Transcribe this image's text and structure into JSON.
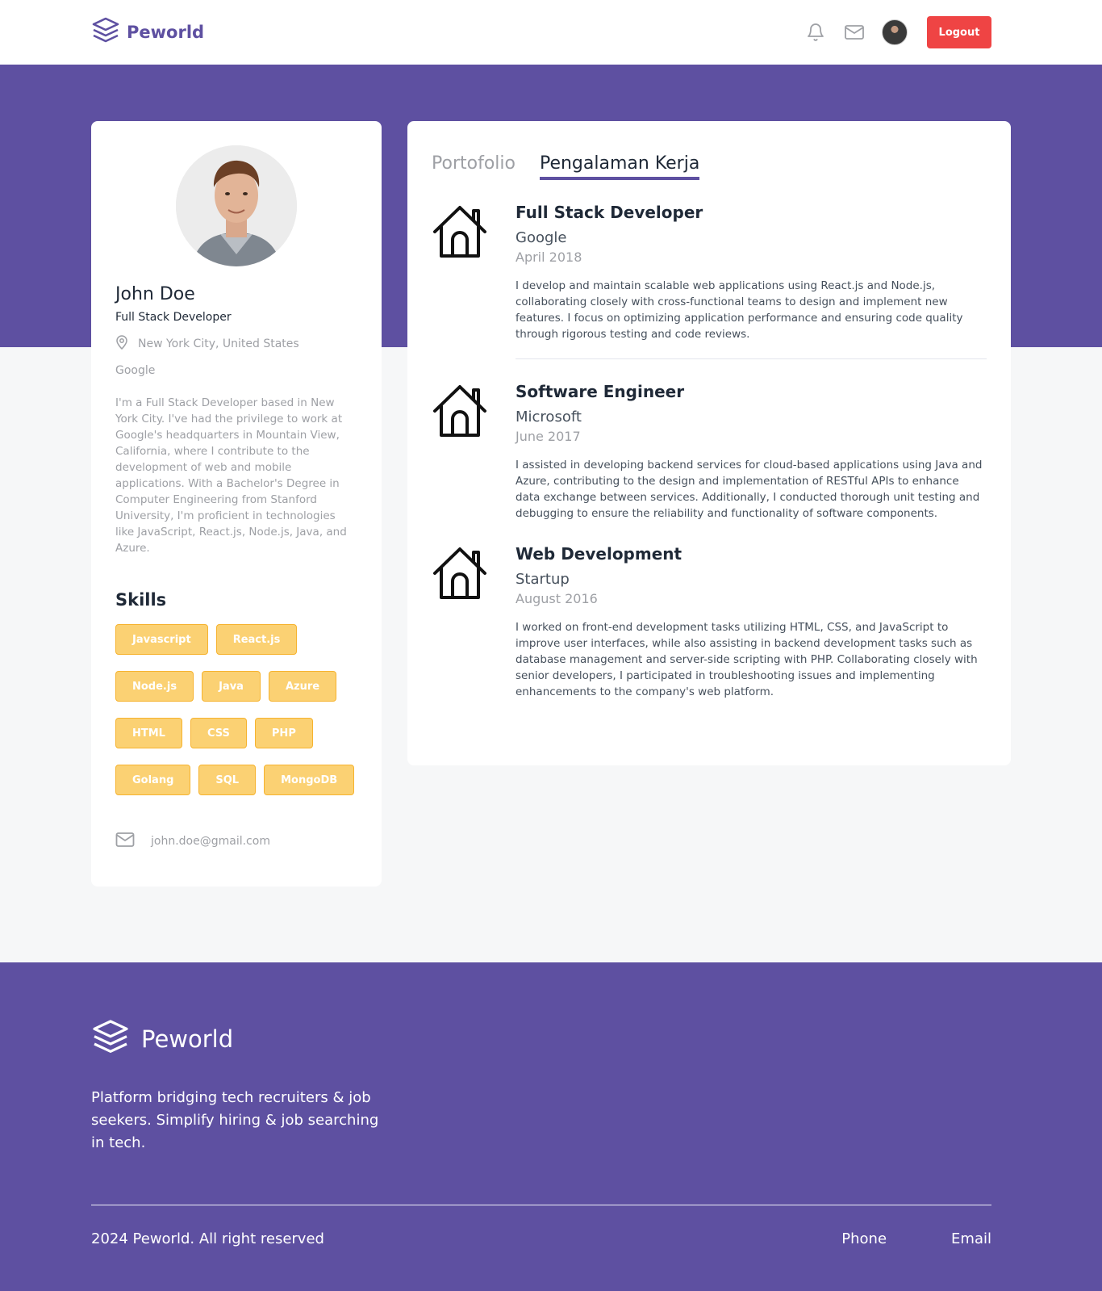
{
  "navbar": {
    "brand": "Peworld",
    "logout_label": "Logout"
  },
  "profile": {
    "name": "John Doe",
    "role": "Full Stack Developer",
    "location": "New York City, United States",
    "company": "Google",
    "bio": "I'm a Full Stack Developer based in New York City. I've had the privilege to work at Google's headquarters in Mountain View, California, where I contribute to the development of web and mobile applications. With a Bachelor's Degree in Computer Engineering from Stanford University, I'm proficient in technologies like JavaScript, React.js, Node.js, Java, and Azure.",
    "skills_title": "Skills",
    "skills": [
      "Javascript",
      "React.js",
      "Node.js",
      "Java",
      "Azure",
      "HTML",
      "CSS",
      "PHP",
      "Golang",
      "SQL",
      "MongoDB"
    ],
    "email": "john.doe@gmail.com"
  },
  "tabs": {
    "portfolio": "Portofolio",
    "experience": "Pengalaman Kerja",
    "active": "experience"
  },
  "experience": [
    {
      "title": "Full Stack Developer",
      "company": "Google",
      "date": "April 2018",
      "description": "I develop and maintain scalable web applications using React.js and Node.js, collaborating closely with cross-functional teams to design and implement new features. I focus on optimizing application performance and ensuring code quality through rigorous testing and code reviews."
    },
    {
      "title": "Software Engineer",
      "company": "Microsoft",
      "date": "June 2017",
      "description": "I assisted in developing backend services for cloud-based applications using Java and Azure, contributing to the design and implementation of RESTful APIs to enhance data exchange between services. Additionally, I conducted thorough unit testing and debugging to ensure the reliability and functionality of software components."
    },
    {
      "title": "Web Development",
      "company": "Startup",
      "date": "August 2016",
      "description": "I worked on front-end development tasks utilizing HTML, CSS, and JavaScript to improve user interfaces, while also assisting in backend development tasks such as database management and server-side scripting with PHP. Collaborating closely with senior developers, I participated in troubleshooting issues and implementing enhancements to the company's web platform."
    }
  ],
  "footer": {
    "brand": "Peworld",
    "tagline": "Platform bridging tech recruiters & job seekers. Simplify hiring & job searching in tech.",
    "copyright": "2024 Peworld. All right reserved",
    "phone": "Phone",
    "email": "Email"
  },
  "colors": {
    "brand": "#5e50a1",
    "logout": "#ef4444",
    "skill_bg": "#fbd173",
    "skill_border": "#f6b32f"
  },
  "icons": {
    "logo": "layers-icon",
    "notification": "bell-icon",
    "messages": "mail-icon",
    "location": "map-pin-icon",
    "experience": "house-icon",
    "email": "mail-icon"
  }
}
